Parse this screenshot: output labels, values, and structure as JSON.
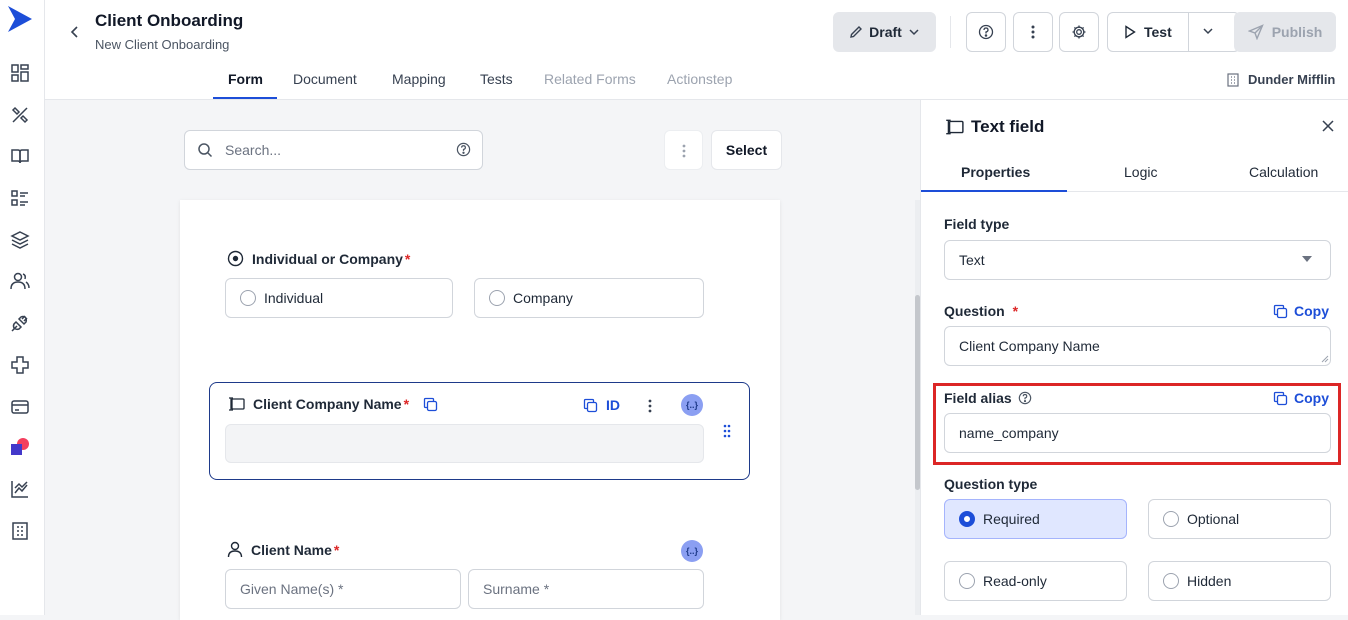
{
  "header": {
    "title": "Client Onboarding",
    "subtitle": "New Client Onboarding",
    "tabs": [
      {
        "label": "Form"
      },
      {
        "label": "Document"
      },
      {
        "label": "Mapping"
      },
      {
        "label": "Tests"
      },
      {
        "label": "Related Forms"
      },
      {
        "label": "Actionstep"
      }
    ],
    "draft_label": "Draft",
    "test_label": "Test",
    "publish_label": "Publish",
    "org_name": "Dunder Mifflin"
  },
  "canvas": {
    "search_placeholder": "Search...",
    "select_label": "Select",
    "questions": {
      "individual_or_company": {
        "label": "Individual or Company",
        "required_mark": "*",
        "options": [
          "Individual",
          "Company"
        ]
      },
      "client_company_name": {
        "label": "Client Company Name",
        "required_mark": "*",
        "id_label": "ID",
        "var_badge": "{..}"
      },
      "client_name": {
        "label": "Client Name",
        "required_mark": "*",
        "var_badge": "{..}",
        "given_placeholder": "Given Name(s) *",
        "surname_placeholder": "Surname *"
      }
    }
  },
  "panel": {
    "title": "Text field",
    "tabs": [
      {
        "label": "Properties"
      },
      {
        "label": "Logic"
      },
      {
        "label": "Calculation"
      }
    ],
    "field_type_label": "Field type",
    "field_type_value": "Text",
    "question_label": "Question",
    "question_required_mark": "*",
    "question_value": "Client Company Name",
    "copy_label": "Copy",
    "field_alias_label": "Field alias",
    "field_alias_value": "name_company",
    "question_type_label": "Question type",
    "question_types": [
      "Required",
      "Optional",
      "Read-only",
      "Hidden"
    ],
    "selected_question_type": "Required"
  },
  "colors": {
    "accent": "#1d4ed8",
    "highlight": "#dc2626",
    "selected_border": "#1e3a8a"
  }
}
